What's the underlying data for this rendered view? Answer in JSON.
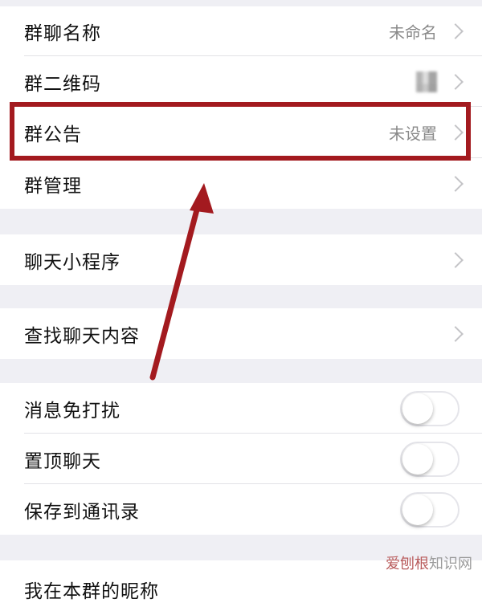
{
  "settings": {
    "group_name": {
      "label": "群聊名称",
      "value": "未命名"
    },
    "group_qr": {
      "label": "群二维码"
    },
    "announcement": {
      "label": "群公告",
      "value": "未设置"
    },
    "management": {
      "label": "群管理"
    },
    "mini_programs": {
      "label": "聊天小程序"
    },
    "search_chat": {
      "label": "查找聊天内容"
    },
    "mute": {
      "label": "消息免打扰",
      "on": false
    },
    "sticky": {
      "label": "置顶聊天",
      "on": false
    },
    "save_contacts": {
      "label": "保存到通讯录",
      "on": false
    },
    "my_nickname": {
      "label": "我在本群的昵称"
    }
  },
  "annotation": {
    "color": "#a31a1f"
  },
  "watermark": {
    "accent": "爱刨根",
    "rest": "知识网"
  }
}
